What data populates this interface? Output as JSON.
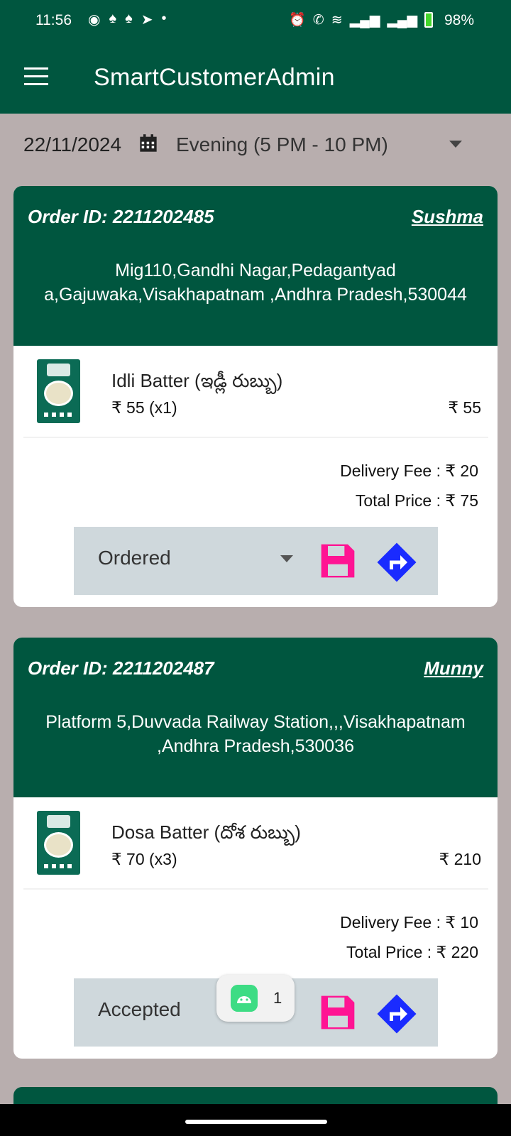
{
  "status_bar": {
    "time": "11:56",
    "battery": "98%"
  },
  "app_bar": {
    "title": "SmartCustomerAdmin",
    "menu_icon": "menu-icon"
  },
  "filter": {
    "date": "22/11/2024",
    "shift": "Evening (5 PM - 10 PM)"
  },
  "orders": [
    {
      "order_id": "Order ID: 2211202485",
      "customer": "Sushma",
      "address": "Mig110,Gandhi Nagar,Pedagantyad a,Gajuwaka,Visakhapatnam ,Andhra Pradesh,530044",
      "item": {
        "name": "Idli Batter (ఇడ్లీ రుబ్బు)",
        "qty": "₹ 55 (x1)",
        "total": "₹ 55"
      },
      "delivery_fee": "Delivery Fee : ₹ 20",
      "total_price": "Total Price : ₹ 75",
      "status": "Ordered"
    },
    {
      "order_id": "Order ID: 2211202487",
      "customer": "Munny",
      "address": "Platform 5,Duvvada Railway Station,,,Visakhapatnam ,Andhra Pradesh,530036",
      "item": {
        "name": "Dosa Batter (దోశ రుబ్బు)",
        "qty": "₹ 70 (x3)",
        "total": "₹ 210"
      },
      "delivery_fee": "Delivery Fee : ₹ 10",
      "total_price": "Total Price : ₹ 220",
      "status": "Accepted"
    }
  ],
  "toast": {
    "count": "1"
  },
  "colors": {
    "primary": "#00563f",
    "save": "#ff1493",
    "directions": "#1a2bff",
    "background": "#b8aeae",
    "action_bar": "#cfd8dc"
  }
}
